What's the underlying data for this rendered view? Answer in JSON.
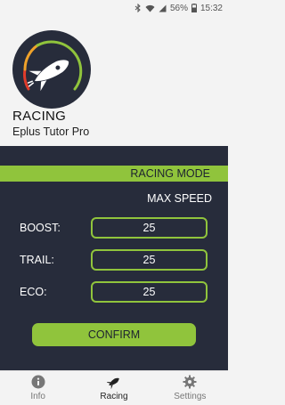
{
  "status_bar": {
    "battery": "56%",
    "time": "15:32",
    "icons": [
      "bluetooth-icon",
      "wifi-icon",
      "signal-icon",
      "battery-icon"
    ]
  },
  "header": {
    "title": "RACING",
    "subtitle": "Eplus Tutor Pro",
    "logo_icon": "rocket-gauge-icon"
  },
  "mode_bar": {
    "label": "RACING MODE"
  },
  "mode_name": "MAX SPEED",
  "settings": [
    {
      "label": "BOOST:",
      "value": "25"
    },
    {
      "label": "TRAIL:",
      "value": "25"
    },
    {
      "label": "ECO:",
      "value": "25"
    }
  ],
  "confirm_label": "CONFIRM",
  "tabs": [
    {
      "label": "Info",
      "icon": "info-icon",
      "active": false
    },
    {
      "label": "Racing",
      "icon": "rocket-icon",
      "active": true
    },
    {
      "label": "Settings",
      "icon": "gear-icon",
      "active": false
    }
  ],
  "colors": {
    "accent": "#90c43c",
    "panel": "#272c3b",
    "background": "#f3f3f3"
  }
}
